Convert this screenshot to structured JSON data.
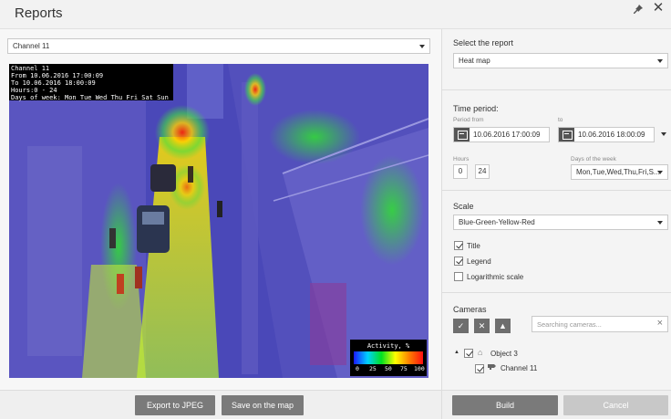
{
  "window": {
    "title": "Reports"
  },
  "left": {
    "channel_select": "Channel 11",
    "osd": {
      "lines": [
        "Channel 11",
        "From 10.06.2016 17:00:09",
        "To 10.06.2016 18:00:09",
        "Hours:0 - 24",
        "Days of week: Mon Tue Wed Thu Fri Sat Sun"
      ]
    },
    "legend": {
      "title": "Activity, %",
      "ticks": [
        "0",
        "25",
        "50",
        "75",
        "100"
      ]
    },
    "buttons": {
      "export": "Export to JPEG",
      "save_map": "Save on the map"
    }
  },
  "right": {
    "report": {
      "label": "Select the report",
      "value": "Heat map"
    },
    "time_period": {
      "label": "Time period:",
      "from_label": "Period from",
      "to_label": "to",
      "from_value": "10.06.2016  17:00:09",
      "to_value": "10.06.2016  18:00:09",
      "hours_label": "Hours",
      "hours_from": "0",
      "hours_to": "24",
      "days_label": "Days of the week",
      "days_value": "Mon,Tue,Wed,Thu,Fri,S..."
    },
    "scale": {
      "label": "Scale",
      "value": "Blue-Green-Yellow-Red",
      "options": [
        {
          "label": "Title",
          "checked": true
        },
        {
          "label": "Legend",
          "checked": true
        },
        {
          "label": "Logarithmic scale",
          "checked": false
        }
      ]
    },
    "cameras": {
      "label": "Cameras",
      "search_placeholder": "Searching cameras...",
      "tree": [
        {
          "label": "Object 3",
          "checked": true
        },
        {
          "label": "Channel 11",
          "checked": true
        }
      ]
    },
    "buttons": {
      "build": "Build",
      "cancel": "Cancel"
    }
  }
}
